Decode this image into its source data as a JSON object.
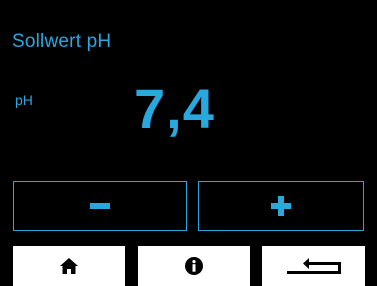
{
  "screen": {
    "title": "Sollwert pH",
    "unit_label": "pH",
    "value": "7,4"
  },
  "controls": {
    "decrease_icon": "minus-icon",
    "increase_icon": "plus-icon"
  },
  "nav": {
    "home_icon": "home-icon",
    "info_icon": "info-icon",
    "back_icon": "return-arrow-icon"
  },
  "colors": {
    "accent": "#29a8e0",
    "background": "#000000",
    "nav_background": "#ffffff",
    "nav_icon": "#000000"
  }
}
